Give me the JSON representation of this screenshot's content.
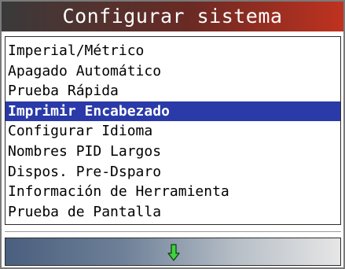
{
  "header": {
    "title": "Configurar sistema"
  },
  "menu": {
    "items": [
      {
        "label": "Imperial/Métrico"
      },
      {
        "label": "Apagado Automático"
      },
      {
        "label": "Prueba Rápida"
      },
      {
        "label": "Imprimir Encabezado"
      },
      {
        "label": "Configurar Idioma"
      },
      {
        "label": "Nombres PID Largos"
      },
      {
        "label": "Dispos. Pre-Dsparo"
      },
      {
        "label": "Información de Herramienta"
      },
      {
        "label": "Prueba de Pantalla"
      }
    ],
    "selected_index": 3
  },
  "footer": {
    "scroll_icon": "arrow-down-icon"
  },
  "colors": {
    "selection": "#2a3aa8",
    "arrow": "#3fd33f",
    "title_accent": "#c0321f"
  }
}
